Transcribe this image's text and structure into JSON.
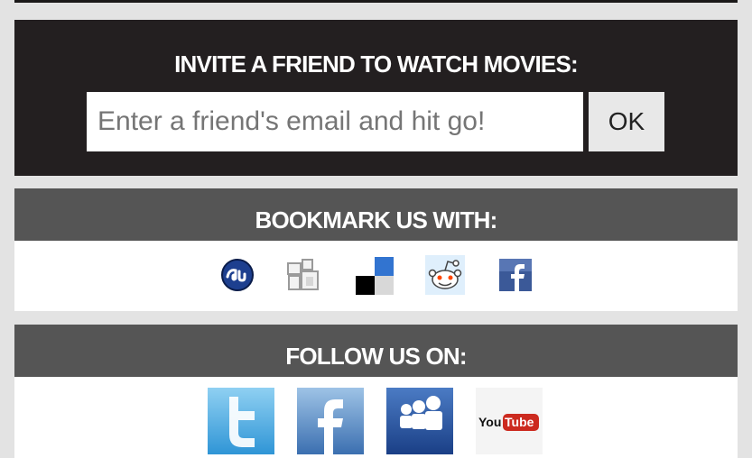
{
  "invite": {
    "title": "INVITE A FRIEND TO WATCH MOVIES:",
    "email_placeholder": "Enter a friend's email and hit go!",
    "ok_label": "OK"
  },
  "bookmark": {
    "title": "BOOKMARK US WITH:",
    "services": [
      {
        "icon": "stumbleupon-icon",
        "color": "#1d3f8f"
      },
      {
        "icon": "mixx-icon",
        "color": "#9a9a9a"
      },
      {
        "icon": "delicious-icon",
        "color": "#3274d0"
      },
      {
        "icon": "reddit-icon",
        "color": "#ff4500"
      },
      {
        "icon": "facebook-icon",
        "color": "#3b5998"
      }
    ]
  },
  "follow": {
    "title": "FOLLOW US ON:",
    "services": [
      {
        "icon": "twitter-icon",
        "color": "#33a3e0"
      },
      {
        "icon": "facebook-icon",
        "color": "#3b6fb0"
      },
      {
        "icon": "myspace-icon",
        "color": "#1f4ea0"
      },
      {
        "icon": "youtube-icon",
        "color": "#cc2a1f"
      }
    ],
    "youtube_you": "You",
    "youtube_tube": "Tube"
  }
}
